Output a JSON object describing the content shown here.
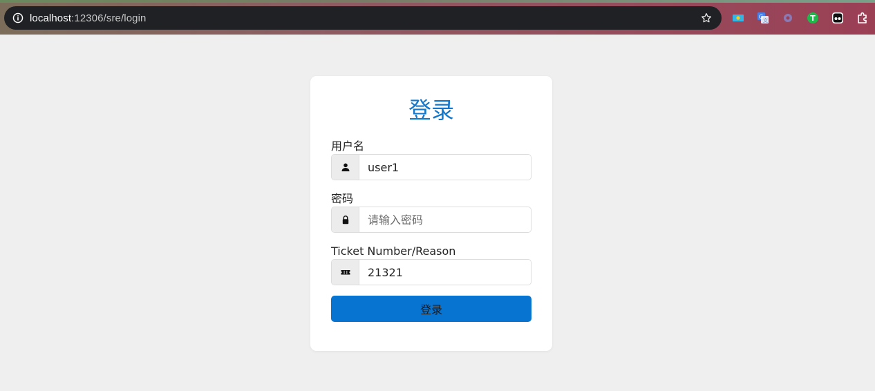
{
  "browser": {
    "url_host": "localhost",
    "url_path": ":12306/sre/login",
    "extensions": [
      "kazakhstan-flag-icon",
      "google-translate-icon",
      "gear-icon",
      "green-t-icon",
      "ghostery-icon",
      "puzzle-icon"
    ]
  },
  "login": {
    "title": "登录",
    "username": {
      "label": "用户名",
      "value": "user1",
      "icon": "user-icon"
    },
    "password": {
      "label": "密码",
      "placeholder": "请输入密码",
      "value": "",
      "icon": "lock-icon"
    },
    "ticket": {
      "label": "Ticket Number/Reason",
      "value": "21321",
      "icon": "ticket-icon"
    },
    "submit_label": "登录"
  },
  "colors": {
    "accent": "#1477c9",
    "button": "#0874d1",
    "page_bg": "#efefef"
  }
}
